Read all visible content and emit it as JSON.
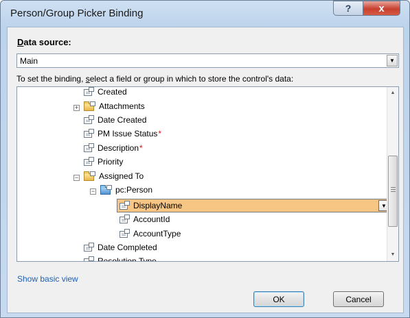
{
  "window": {
    "title": "Person/Group Picker Binding",
    "help_glyph": "?",
    "close_glyph": "x"
  },
  "data_source": {
    "label_underlined": "D",
    "label_rest": "ata source:",
    "value": "Main"
  },
  "instruction": {
    "prefix": "To set the binding, ",
    "underlined": "s",
    "suffix": "elect a field or group in which to store the control's data:"
  },
  "tree": {
    "items": [
      {
        "label": "Created",
        "kind": "field",
        "required": false
      },
      {
        "label": "Attachments",
        "kind": "group",
        "required": false,
        "expander": "+"
      },
      {
        "label": "Date Created",
        "kind": "field",
        "required": false
      },
      {
        "label": "PM Issue Status",
        "kind": "field",
        "required": true
      },
      {
        "label": "Description",
        "kind": "field",
        "required": true
      },
      {
        "label": "Priority",
        "kind": "field",
        "required": false
      },
      {
        "label": "Assigned To",
        "kind": "group",
        "required": false,
        "expander": "−"
      },
      {
        "label": "pc:Person",
        "kind": "group",
        "required": false,
        "expander": "−"
      },
      {
        "label": "DisplayName",
        "kind": "field",
        "required": false,
        "selected": true
      },
      {
        "label": "AccountId",
        "kind": "field",
        "required": false
      },
      {
        "label": "AccountType",
        "kind": "field",
        "required": false
      },
      {
        "label": "Date Completed",
        "kind": "field",
        "required": false
      },
      {
        "label": "Resolution Type",
        "kind": "field",
        "required": false
      }
    ],
    "required_marker": "*",
    "selected_color": "#f7c685"
  },
  "footer": {
    "show_basic_view": "Show basic view",
    "ok_label": "OK",
    "cancel_label": "Cancel"
  }
}
